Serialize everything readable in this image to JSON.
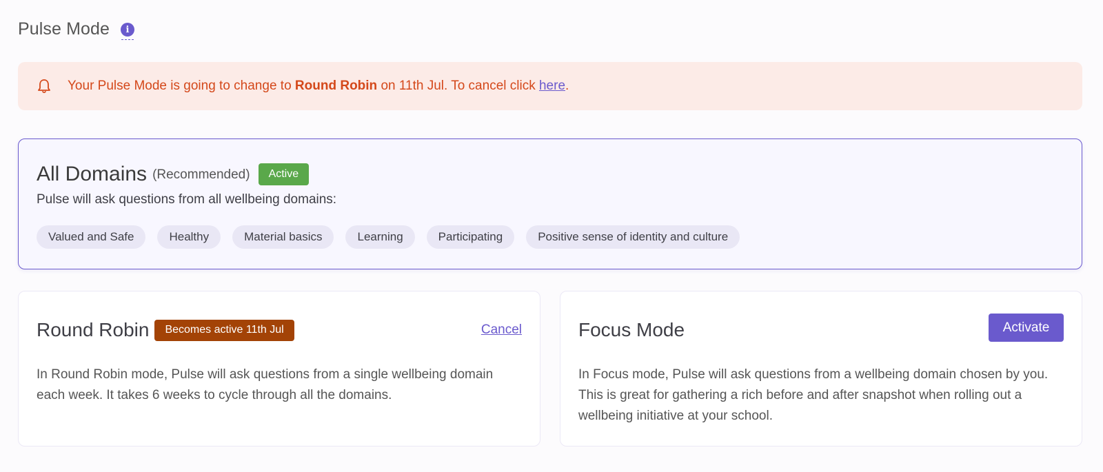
{
  "header": {
    "title": "Pulse Mode",
    "info_icon": "info-icon"
  },
  "alert": {
    "icon": "bell-icon",
    "text_prefix": "Your Pulse Mode is going to change to ",
    "bold_text": "Round Robin",
    "text_middle": " on 11th Jul. To cancel click ",
    "link_text": "here",
    "text_suffix": ".",
    "color": "#d4481a",
    "background": "#fcebe7"
  },
  "all_domains": {
    "title": "All Domains",
    "recommended": "(Recommended)",
    "badge": "Active",
    "subtitle": "Pulse will ask questions from all wellbeing domains:",
    "domains": [
      "Valued and Safe",
      "Healthy",
      "Material basics",
      "Learning",
      "Participating",
      "Positive sense of identity and culture"
    ]
  },
  "round_robin": {
    "title": "Round Robin",
    "badge": "Becomes active 11th Jul",
    "cancel_label": "Cancel",
    "description": "In Round Robin mode, Pulse will ask questions from a single wellbeing domain each week. It takes 6 weeks to cycle through all the domains."
  },
  "focus_mode": {
    "title": "Focus Mode",
    "activate_label": "Activate",
    "description": "In Focus mode, Pulse will ask questions from a wellbeing domain chosen by you. This is great for gathering a rich before and after snapshot when rolling out a wellbeing initiative at your school."
  },
  "colors": {
    "accent": "#6a5acd",
    "active_badge": "#5aa84a",
    "pending_badge": "#a34306"
  }
}
